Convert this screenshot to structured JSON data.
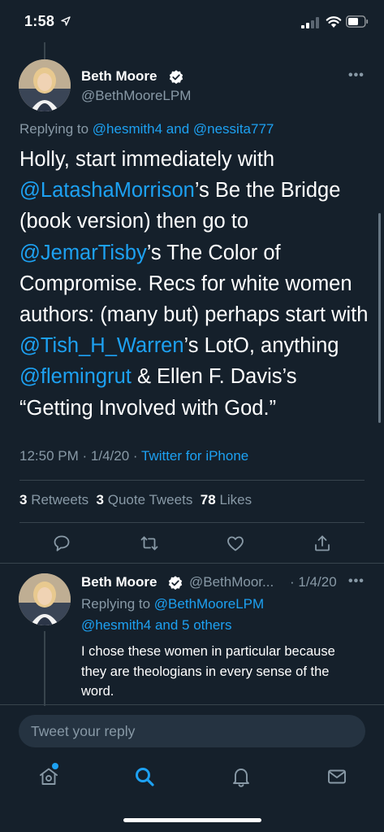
{
  "status_bar": {
    "time": "1:58"
  },
  "tweet": {
    "author_name": "Beth Moore",
    "author_handle": "@BethMooreLPM",
    "replying_prefix": "Replying to",
    "replying_to_1": "@hesmith4",
    "replying_and": "and",
    "replying_to_2": "@nessita777",
    "body": {
      "s1": "Holly, start immediately with",
      "m1": "@LatashaMorrison",
      "s2": "’s Be the Bridge (book version) then go to",
      "m2": "@JemarTisby",
      "s3": "’s The Color of Compromise. Recs for white women authors: (many but) perhaps start with",
      "m3": "@Tish_H_Warren",
      "s4": "’s LotO, anything",
      "m4": "@flemingrut",
      "s5": "& Ellen F. Davis’s “Getting Involved with God.”"
    },
    "time": "12:50 PM",
    "date": "1/4/20",
    "source": "Twitter for iPhone",
    "retweets_count": "3",
    "retweets_label": "Retweets",
    "quote_count": "3",
    "quote_label": "Quote Tweets",
    "likes_count": "78",
    "likes_label": "Likes"
  },
  "reply": {
    "author_name": "Beth Moore",
    "author_handle": "@BethMoor...",
    "date": "· 1/4/20",
    "replying_prefix": "Replying to",
    "replying_to": "@BethMooreLPM",
    "replying_others": "@hesmith4 and 5 others",
    "text": "I chose these women in particular because they are theologians in every sense of the word."
  },
  "composer": {
    "placeholder": "Tweet your reply"
  },
  "colors": {
    "background": "#15202b",
    "accent": "#1da1f2",
    "muted": "#8899a6",
    "divider": "#38444d"
  },
  "icons": [
    "location-arrow-icon",
    "signal-icon",
    "wifi-icon",
    "battery-icon",
    "verified-icon",
    "more-icon",
    "reply-icon",
    "retweet-icon",
    "like-icon",
    "share-icon",
    "home-icon",
    "search-icon",
    "notifications-icon",
    "messages-icon"
  ]
}
